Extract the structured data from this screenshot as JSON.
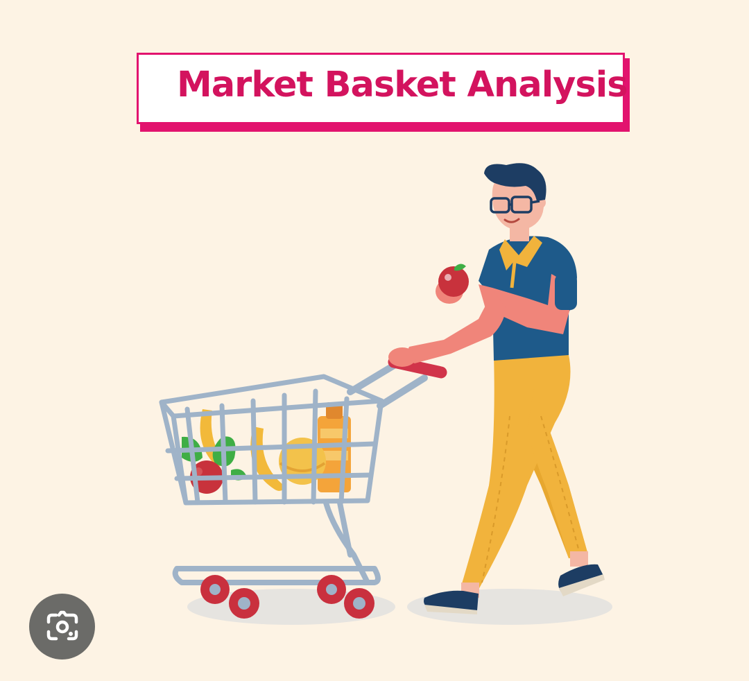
{
  "title": {
    "text": "Market Basket Analysis"
  },
  "colors": {
    "background": "#fdf3e4",
    "title_accent": "#e2136e",
    "title_text": "#d3135e",
    "shirt": "#1e5a8a",
    "pants": "#f1b33c",
    "cart": "#9fb3c8",
    "wheel": "#c9303e"
  },
  "icons": {
    "lens": "visual-search-camera-icon"
  }
}
